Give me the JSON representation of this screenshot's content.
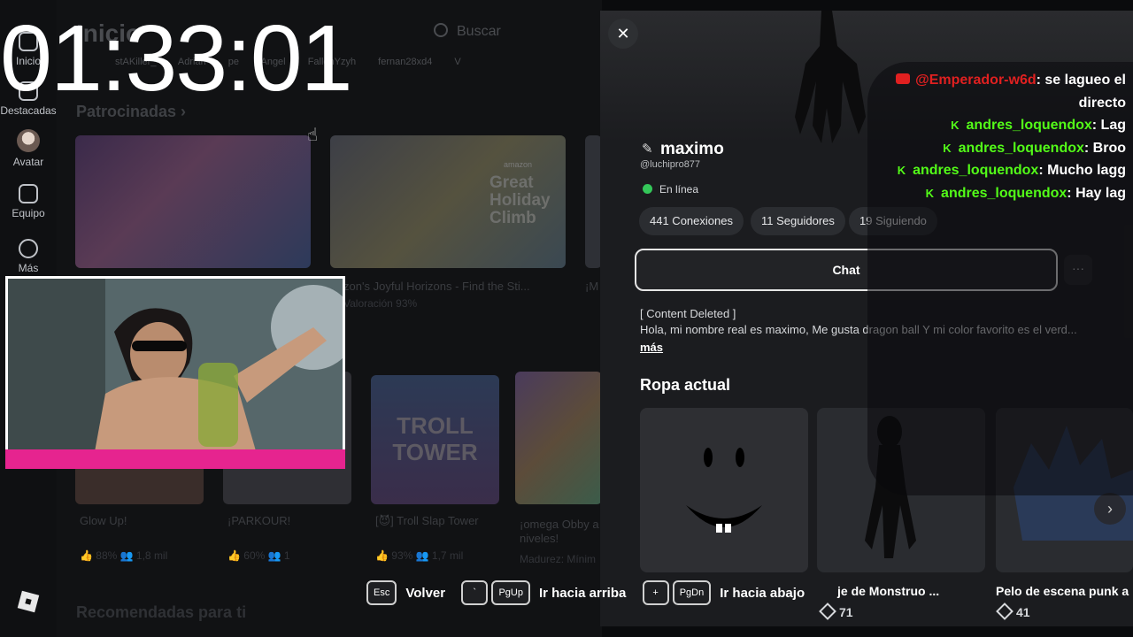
{
  "stream_overlay": {
    "timer": "01:33:01",
    "chat": [
      {
        "platform": "youtube",
        "user": "@Emperador-w6d",
        "text": "se lagueo el directo"
      },
      {
        "platform": "kick",
        "user": "andres_loquendox",
        "text": "Lag"
      },
      {
        "platform": "kick",
        "user": "andres_loquendox",
        "text": "Broo"
      },
      {
        "platform": "kick",
        "user": "andres_loquendox",
        "text": "Mucho lagg"
      },
      {
        "platform": "kick",
        "user": "andres_loquendox",
        "text": "Hay lag"
      }
    ]
  },
  "sidebar": {
    "items": [
      {
        "label": "Inicio",
        "icon": "home-icon"
      },
      {
        "label": "Destacadas",
        "icon": "featured-icon"
      },
      {
        "label": "Avatar",
        "icon": "avatar-icon"
      },
      {
        "label": "Equipo",
        "icon": "team-icon"
      },
      {
        "label": "Más",
        "icon": "more-icon"
      }
    ]
  },
  "home": {
    "title": "Inicio",
    "search_placeholder": "Buscar",
    "friends": [
      "stAKiller_",
      "Adrian",
      "pe",
      "Angel",
      "FallenYzyh",
      "fernan28xd4",
      "V"
    ],
    "sponsored_label": "Patrocinadas",
    "sponsored_tiles": [
      {
        "title": "",
        "meta": ""
      },
      {
        "title": "mazon's Joyful Horizons - Find the Sti...",
        "meta": "Valoración 93%",
        "badge": "amazon",
        "art_text": "Great Holiday Climb"
      },
      {
        "title": "¡M",
        "meta": ""
      }
    ],
    "games": [
      {
        "title": "Glow Up!",
        "rating": "88%",
        "players": "1,8 mil"
      },
      {
        "title": "¡PARKOUR!",
        "rating": "60%",
        "players": "1"
      },
      {
        "title": "[😈] Troll Slap Tower",
        "rating": "93%",
        "players": "1,7 mil",
        "art_text": "TROLL TOWER"
      },
      {
        "title": "¡omega Obby a niveles!",
        "meta": "Madurez: Mínim"
      }
    ],
    "recommended_label": "Recomendadas para ti"
  },
  "profile": {
    "display_name": "maximo",
    "username": "@luchipro877",
    "status": "En línea",
    "stats": {
      "connections": "441 Conexiones",
      "followers": "11 Seguidores",
      "following": "19 Siguiendo"
    },
    "chat_button": "Chat",
    "more_button": "···",
    "about_line1": "[ Content Deleted ]",
    "about_line2": "Hola, mi nombre real es maximo, Me gusta dragon ball Y mi color favorito es el verd...",
    "more_link": "más",
    "outfit_title": "Ropa actual",
    "outfit_items": [
      {
        "name": "",
        "price": ""
      },
      {
        "name": "je de Monstruo ...",
        "price": "71"
      },
      {
        "name": "Pelo de escena punk a",
        "price": "41"
      }
    ]
  },
  "key_hints": [
    {
      "keys": [
        "Esc"
      ],
      "label": "Volver"
    },
    {
      "keys": [
        "`",
        "PgUp"
      ],
      "label": "Ir hacia arriba"
    },
    {
      "keys": [
        "+",
        "PgDn"
      ],
      "label": "Ir hacia abajo"
    }
  ],
  "colors": {
    "youtube_red": "#e02020",
    "kick_green": "#53fc18",
    "online_green": "#34c759",
    "webcam_accent": "#e6248f"
  }
}
